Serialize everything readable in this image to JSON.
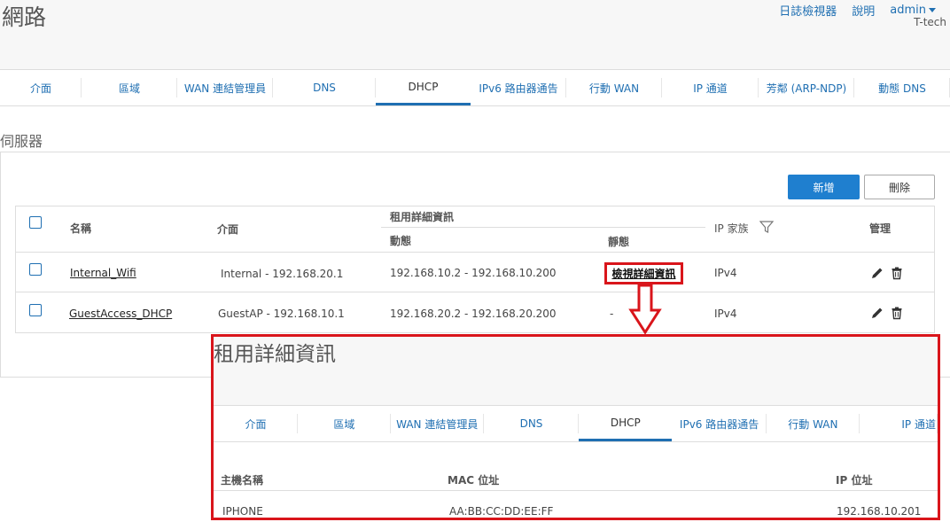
{
  "header": {
    "title": "網路",
    "links": [
      "日誌檢視器",
      "說明",
      "admin"
    ],
    "company": "T-tech"
  },
  "tabs": [
    {
      "label": "介面",
      "width": 100
    },
    {
      "label": "區域",
      "width": 108
    },
    {
      "label": "WAN 連結管理員",
      "width": 108
    },
    {
      "label": "DNS",
      "width": 108
    },
    {
      "label": "DHCP",
      "width": 108,
      "active": true
    },
    {
      "label": "IPv6 路由器通告",
      "width": 108
    },
    {
      "label": "行動 WAN",
      "width": 108
    },
    {
      "label": "IP 通道",
      "width": 108
    },
    {
      "label": "芳鄰 (ARP-NDP)",
      "width": 108
    },
    {
      "label": "動態 DNS",
      "width": 108
    }
  ],
  "section": {
    "label": "伺服器"
  },
  "toolbar": {
    "add_label": "新增",
    "delete_label": "刪除"
  },
  "table": {
    "headers": {
      "name": "名稱",
      "interface": "介面",
      "lease_details": "租用詳細資訊",
      "dynamic": "動態",
      "static": "靜態",
      "ip_family": "IP 家族",
      "manage": "管理"
    },
    "rows": [
      {
        "name": "Internal_Wifi",
        "interface": "Internal - 192.168.20.1",
        "dynamic": "192.168.10.2 - 192.168.10.200",
        "static": "檢視詳細資訊",
        "family": "IPv4"
      },
      {
        "name": "GuestAccess_DHCP",
        "interface": "GuestAP - 192.168.10.1",
        "dynamic": "192.168.20.2 - 192.168.20.200",
        "static": "-",
        "family": "IPv4"
      }
    ]
  },
  "overlay": {
    "title": "租用詳細資訊",
    "tabs": [
      "介面",
      "區域",
      "WAN 連結管理員",
      "DNS",
      "DHCP",
      "IPv6 路由器通告",
      "行動 WAN",
      "IP 通道"
    ],
    "headers": {
      "host": "主機名稱",
      "mac": "MAC 位址",
      "ip": "IP 位址"
    },
    "row": {
      "host": "IPHONE",
      "mac": "AA:BB:CC:DD:EE:FF",
      "ip": "192.168.10.201"
    }
  },
  "colors": {
    "accent": "#1f7fcf",
    "highlight": "#d9151b"
  }
}
